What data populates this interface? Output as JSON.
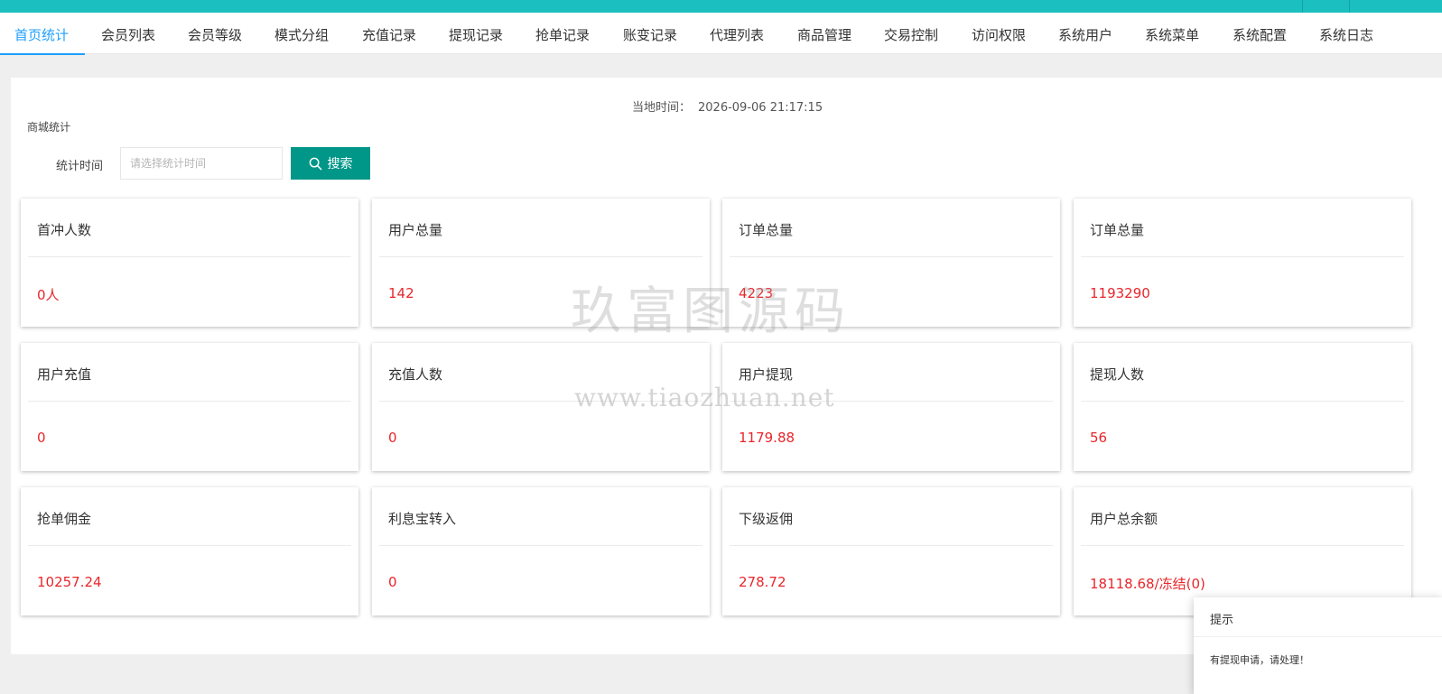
{
  "topbar": {
    "accent_color": "#1bbfc0"
  },
  "nav": {
    "active_color": "#1e9fff",
    "tabs": [
      {
        "label": "首页统计"
      },
      {
        "label": "会员列表"
      },
      {
        "label": "会员等级"
      },
      {
        "label": "模式分组"
      },
      {
        "label": "充值记录"
      },
      {
        "label": "提现记录"
      },
      {
        "label": "抢单记录"
      },
      {
        "label": "账变记录"
      },
      {
        "label": "代理列表"
      },
      {
        "label": "商品管理"
      },
      {
        "label": "交易控制"
      },
      {
        "label": "访问权限"
      },
      {
        "label": "系统用户"
      },
      {
        "label": "系统菜单"
      },
      {
        "label": "系统配置"
      },
      {
        "label": "系统日志"
      }
    ]
  },
  "header": {
    "local_time_label": "当地时间：",
    "local_time_value": "2026-09-06 21:17:15",
    "section_title": "商城统计"
  },
  "filter": {
    "label": "统计时间",
    "placeholder": "请选择统计时间",
    "search_label": "搜索",
    "button_color": "#009688",
    "search_icon": "search-icon"
  },
  "cards": [
    {
      "title": "首冲人数",
      "value": "0人"
    },
    {
      "title": "用户总量",
      "value": "142"
    },
    {
      "title": "订单总量",
      "value": "4223"
    },
    {
      "title": "订单总量",
      "value": "1193290"
    },
    {
      "title": "用户充值",
      "value": "0"
    },
    {
      "title": "充值人数",
      "value": "0"
    },
    {
      "title": "用户提现",
      "value": "1179.88"
    },
    {
      "title": "提现人数",
      "value": "56"
    },
    {
      "title": "抢单佣金",
      "value": "10257.24"
    },
    {
      "title": "利息宝转入",
      "value": "0"
    },
    {
      "title": "下级返佣",
      "value": "278.72"
    },
    {
      "title": "用户总余额",
      "value": "18118.68/冻结(0)"
    }
  ],
  "value_color": "#e8262b",
  "watermark": {
    "text_cn": "玖富图源码",
    "text_url": "www.tiaozhuan.net"
  },
  "notice": {
    "title": "提示",
    "body": "有提现申请，请处理！"
  }
}
